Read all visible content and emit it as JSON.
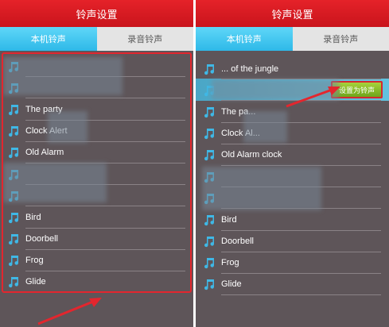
{
  "left": {
    "title": "铃声设置",
    "tabs": [
      {
        "label": "本机铃声"
      },
      {
        "label": "录音铃声"
      }
    ],
    "items": [
      {
        "label": ""
      },
      {
        "label": ""
      },
      {
        "label": "The party"
      },
      {
        "label": "Clock Alert"
      },
      {
        "label": "Old Alarm"
      },
      {
        "label": ""
      },
      {
        "label": ""
      },
      {
        "label": "Bird"
      },
      {
        "label": "Doorbell"
      },
      {
        "label": "Frog"
      },
      {
        "label": "Glide"
      }
    ]
  },
  "right": {
    "title": "铃声设置",
    "tabs": [
      {
        "label": "本机铃声"
      },
      {
        "label": "录音铃声"
      }
    ],
    "items": [
      {
        "label": "... of the jungle"
      },
      {
        "label": ""
      },
      {
        "label": "The pa..."
      },
      {
        "label": "Clock Al..."
      },
      {
        "label": "Old Alarm clock"
      },
      {
        "label": ""
      },
      {
        "label": ""
      },
      {
        "label": "Bird"
      },
      {
        "label": "Doorbell"
      },
      {
        "label": "Frog"
      },
      {
        "label": "Glide"
      }
    ],
    "set_button": "设置为铃声"
  },
  "colors": {
    "titlebar": "#d8161e",
    "tab_active": "#3ec4f0",
    "tab_inactive": "#e4e4e4",
    "background": "#5e5559",
    "note_icon": "#3fb8e6",
    "highlight_border": "#e3262e",
    "button": "#8cc22a"
  },
  "icons": {
    "list_item": "music-note-icon",
    "annotation": "red-arrow-icon"
  }
}
